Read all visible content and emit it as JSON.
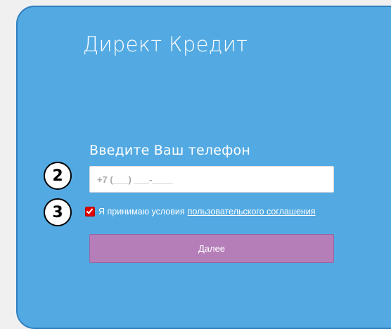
{
  "colors": {
    "panel_bg": "#53aae3",
    "button_bg": "#b57eb8",
    "checkbox": "#e00000",
    "page_bg": "#f0f0f0"
  },
  "form": {
    "title": "Директ Кредит",
    "subtitle": "Введите Ваш телефон",
    "phone_placeholder": "+7 (___) ___-____",
    "phone_value": "",
    "agree_checked": true,
    "agree_text": "Я принимаю условия",
    "agree_link": "пользовательского соглашения",
    "next_label": "Далее"
  },
  "annotations": {
    "badge_phone": "2",
    "badge_agree": "3"
  }
}
